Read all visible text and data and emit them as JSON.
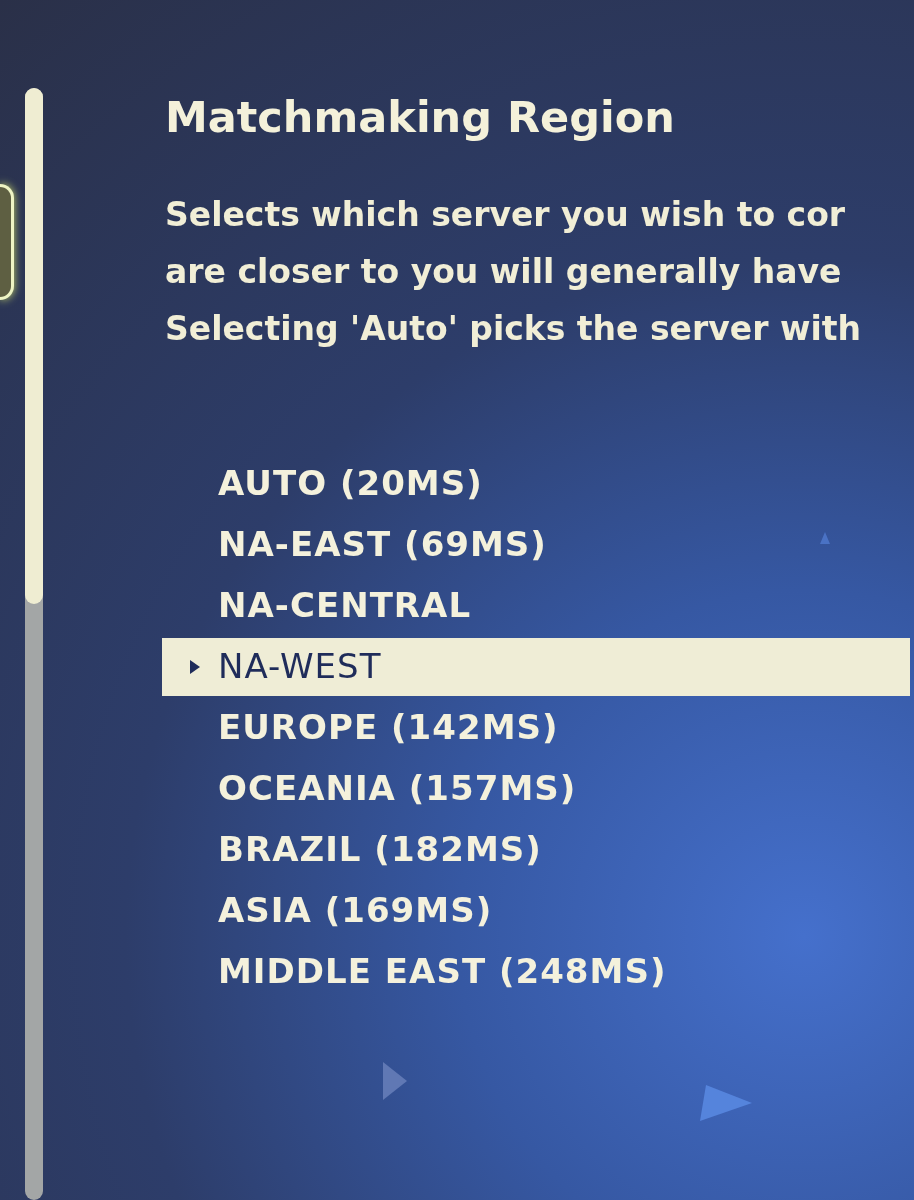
{
  "title": "Matchmaking Region",
  "description": {
    "lines": [
      "Selects which server you wish to cor",
      "are closer to you will generally have",
      "Selecting 'Auto' picks the server with"
    ]
  },
  "regions": [
    {
      "label": "AUTO (20MS)",
      "selected": false
    },
    {
      "label": "NA-EAST (69MS)",
      "selected": false
    },
    {
      "label": "NA-CENTRAL",
      "selected": false
    },
    {
      "label": "NA-WEST",
      "selected": true
    },
    {
      "label": "EUROPE (142MS)",
      "selected": false
    },
    {
      "label": "OCEANIA (157MS)",
      "selected": false
    },
    {
      "label": "BRAZIL (182MS)",
      "selected": false
    },
    {
      "label": "ASIA (169MS)",
      "selected": false
    },
    {
      "label": "MIDDLE EAST (248MS)",
      "selected": false
    }
  ]
}
